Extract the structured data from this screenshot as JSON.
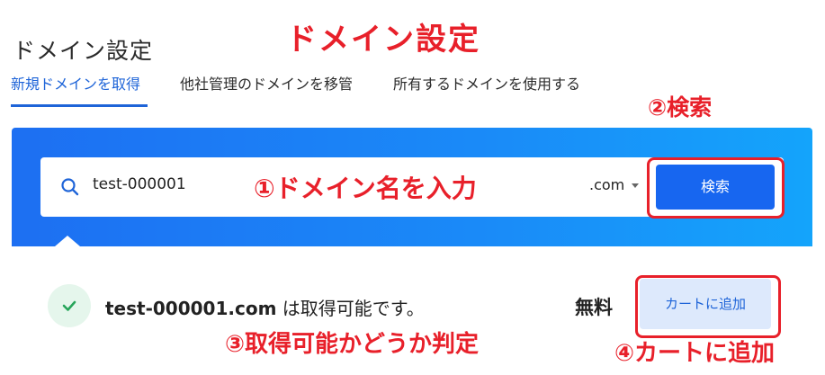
{
  "page": {
    "title": "ドメイン設定"
  },
  "tabs": [
    {
      "label": "新規ドメインを取得",
      "active": true
    },
    {
      "label": "他社管理のドメインを移管",
      "active": false
    },
    {
      "label": "所有するドメインを使用する",
      "active": false
    }
  ],
  "search": {
    "value": "test-000001",
    "tld": ".com",
    "button_label": "検索",
    "icon": "search-icon"
  },
  "result": {
    "domain": "test-000001.com",
    "message": " は取得可能です。",
    "price": "無料",
    "cart_button_label": "カートに追加",
    "status_icon": "check-icon"
  },
  "annotations": {
    "title": "ドメイン設定",
    "step1": "①ドメイン名を入力",
    "step2": "②検索",
    "step3": "③取得可能かどうか判定",
    "step4": "④カートに追加"
  },
  "colors": {
    "accent": "#1e64d8",
    "panel_start": "#1d6ff2",
    "panel_end": "#14a4fb",
    "annotation": "#e8202a",
    "success": "#27a55a"
  }
}
